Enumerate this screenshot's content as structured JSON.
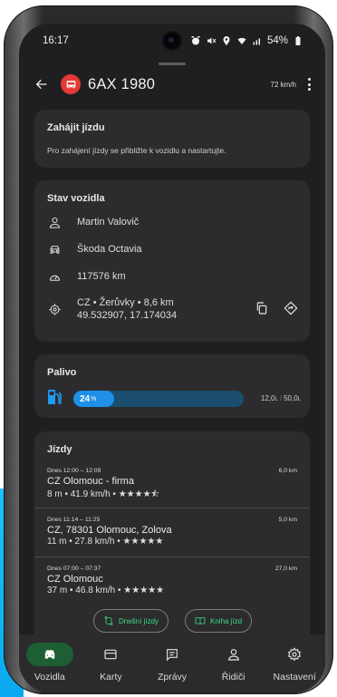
{
  "status_bar": {
    "time": "16:17",
    "battery": "54%"
  },
  "app_bar": {
    "title": "6AX 1980",
    "speed": "72 km/h"
  },
  "start_trip": {
    "title": "Zahájit jízdu",
    "description": "Pro zahájení jízdy se přibližte k vozidlu a nastartujte."
  },
  "vehicle_state": {
    "title": "Stav vozidla",
    "driver": "Martin Valovič",
    "car": "Škoda Octavia",
    "odometer": "117576 km",
    "location_line1": "CZ • Žerůvky • 8,6 km",
    "location_line2": "49.532907, 17.174034"
  },
  "fuel": {
    "title": "Palivo",
    "percent_value": 24,
    "percent": "24",
    "percent_symbol": "%",
    "current": "12,0",
    "current_unit": "L",
    "capacity": "50,0",
    "capacity_unit": "L",
    "separator": "/"
  },
  "trips": {
    "title": "Jízdy",
    "items": [
      {
        "time": "Dnes 12:00 – 12:09",
        "distance": "6,0 km",
        "place": "CZ Olomouc - firma",
        "meta": "8 m • 41.9 km/h • ★★★★⯪"
      },
      {
        "time": "Dnes 11:14 – 11:25",
        "distance": "5,0 km",
        "place": "CZ, 78301 Olomouc, Zolova",
        "meta": "11 m • 27.8 km/h • ★★★★★"
      },
      {
        "time": "Dnes 07:00 – 07:37",
        "distance": "27,0 km",
        "place": "CZ Olomouc",
        "meta": "37 m • 46.8 km/h • ★★★★★"
      }
    ],
    "today_button": "Dnešní jízdy",
    "logbook_button": "Kniha jízd"
  },
  "bottom_nav": [
    {
      "label": "Vozidla",
      "icon": "car-icon",
      "active": true
    },
    {
      "label": "Karty",
      "icon": "card-icon",
      "active": false
    },
    {
      "label": "Zprávy",
      "icon": "message-icon",
      "active": false
    },
    {
      "label": "Řidiči",
      "icon": "person-icon",
      "active": false
    },
    {
      "label": "Nastavení",
      "icon": "gear-icon",
      "active": false
    }
  ],
  "colors": {
    "accent_green": "#3ddc84",
    "fuel_blue": "#1e90e8",
    "badge_red": "#e53935",
    "surface": "#2c2c2f",
    "background": "#1f1f21"
  }
}
